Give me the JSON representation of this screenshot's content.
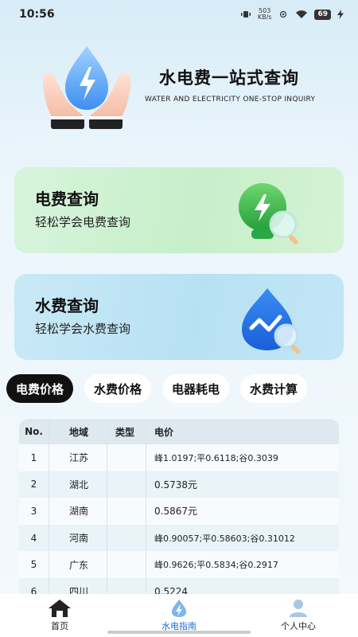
{
  "status": {
    "time": "10:56",
    "speed_value": "503",
    "speed_unit": "KB/s",
    "battery": "69"
  },
  "hero": {
    "title": "水电费一站式查询",
    "subtitle": "WATER AND ELECTRICITY ONE-STOP INQUIRY"
  },
  "cards": {
    "electricity": {
      "title": "电费查询",
      "subtitle": "轻松学会电费查询"
    },
    "water": {
      "title": "水费查询",
      "subtitle": "轻松学会水费查询"
    }
  },
  "tabs": [
    {
      "label": "电费价格",
      "active": true
    },
    {
      "label": "水费价格",
      "active": false
    },
    {
      "label": "电器耗电",
      "active": false
    },
    {
      "label": "水费计算",
      "active": false
    }
  ],
  "table": {
    "headers": {
      "no": "No.",
      "region": "地域",
      "type": "类型",
      "price": "电价"
    },
    "rows": [
      {
        "no": "1",
        "region": "江苏",
        "type": "",
        "price": "峰1.0197;平0.6118;谷0.3039"
      },
      {
        "no": "2",
        "region": "湖北",
        "type": "",
        "price": "0.5738元"
      },
      {
        "no": "3",
        "region": "湖南",
        "type": "",
        "price": "0.5867元"
      },
      {
        "no": "4",
        "region": "河南",
        "type": "",
        "price": "峰0.90057;平0.58603;谷0.31012"
      },
      {
        "no": "5",
        "region": "广东",
        "type": "",
        "price": "峰0.9626;平0.5834;谷0.2917"
      },
      {
        "no": "6",
        "region": "四川",
        "type": "",
        "price": "0.5224"
      }
    ]
  },
  "nav": {
    "home": "首页",
    "guide": "水电指南",
    "profile": "个人中心"
  },
  "colors": {
    "accent_blue": "#1f6fd1",
    "green_card": "#c6efc9",
    "blue_card": "#b7e1f3",
    "active_tab": "#111111"
  }
}
